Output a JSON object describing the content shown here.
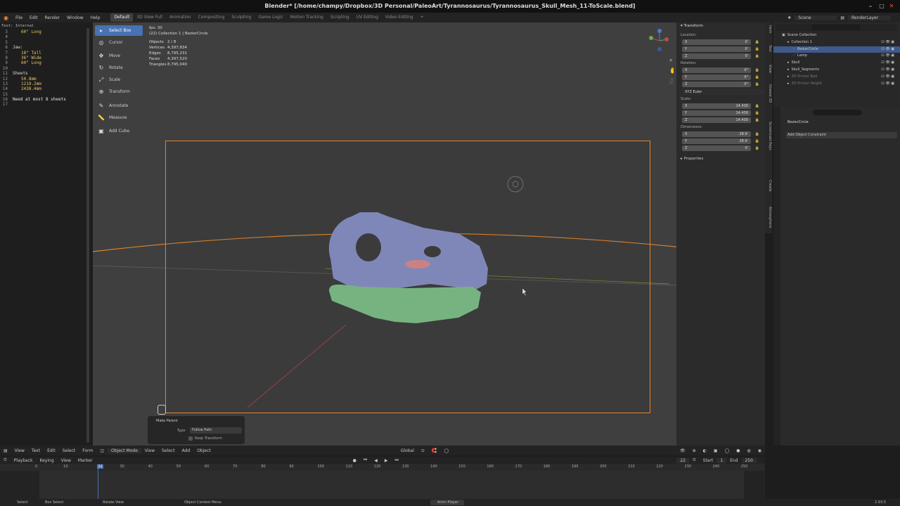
{
  "window": {
    "title": "Blender* [/home/champy/Dropbox/3D Personal/PaleoArt/Tyrannosaurus/Tyrannosaurus_Skull_Mesh_11-ToScale.blend]",
    "controls": [
      "–",
      "□",
      "✕"
    ]
  },
  "menu": [
    "File",
    "Edit",
    "Render",
    "Window",
    "Help"
  ],
  "workspaces": [
    "Default",
    "3D View Full",
    "Animation",
    "Compositing",
    "Sculpting",
    "Game Logic",
    "Motion Tracking",
    "Scripting",
    "UV Editing",
    "Video Editing",
    "+"
  ],
  "top_right": {
    "scene": "Scene",
    "render_layer": "RenderLayer"
  },
  "text_editor": {
    "header": "Text: Internal",
    "lines": [
      {
        "n": "3",
        "t": "60\" Long"
      },
      {
        "n": "4",
        "t": ""
      },
      {
        "n": "5",
        "t": ""
      },
      {
        "n": "6",
        "t": "Jaw:"
      },
      {
        "n": "7",
        "t": "18\" Tall"
      },
      {
        "n": "8",
        "t": "36\" Wide"
      },
      {
        "n": "9",
        "t": "60\" Long"
      },
      {
        "n": "10",
        "t": ""
      },
      {
        "n": "11",
        "t": "Sheets"
      },
      {
        "n": "12",
        "t": "50.8mm"
      },
      {
        "n": "13",
        "t": "1219.2mm"
      },
      {
        "n": "14",
        "t": "2438.4mm"
      },
      {
        "n": "15",
        "t": ""
      },
      {
        "n": "16",
        "t": "Need at most 8 sheets"
      },
      {
        "n": "17",
        "t": ""
      }
    ],
    "menu": [
      "View",
      "Text",
      "Edit",
      "Select",
      "Form"
    ]
  },
  "toolbar": [
    {
      "label": "Select Box",
      "icon": "select-box-icon",
      "glyph": "▸",
      "active": true
    },
    {
      "label": "Cursor",
      "icon": "cursor-icon",
      "glyph": "◎"
    },
    {
      "label": "Move",
      "icon": "move-icon",
      "glyph": "✥"
    },
    {
      "label": "Rotate",
      "icon": "rotate-icon",
      "glyph": "↻"
    },
    {
      "label": "Scale",
      "icon": "scale-icon",
      "glyph": "⤢"
    },
    {
      "label": "Transform",
      "icon": "transform-icon",
      "glyph": "⊕"
    },
    {
      "label": "Annotate",
      "icon": "annotate-icon",
      "glyph": "✎"
    },
    {
      "label": "Measure",
      "icon": "measure-icon",
      "glyph": "📏"
    },
    {
      "label": "Add Cube",
      "icon": "add-cube-icon",
      "glyph": "▣"
    }
  ],
  "stats": {
    "fps": "fps: 30",
    "collection": "(22) Collection 1 | BezierCircle",
    "rows": [
      {
        "k": "Objects",
        "v": "2 / 8"
      },
      {
        "k": "Vertices",
        "v": "4,397,834"
      },
      {
        "k": "Edges",
        "v": "8,795,231"
      },
      {
        "k": "Faces",
        "v": "4,397,520"
      },
      {
        "k": "Triangles",
        "v": "8,795,040"
      }
    ]
  },
  "operator_panel": {
    "title": "Make Parent",
    "type_label": "Type",
    "type_value": "Follow Path",
    "keep_transform": "Keep Transform"
  },
  "viewport_header": {
    "mode": "Object Mode",
    "menu": [
      "View",
      "Select",
      "Add",
      "Object"
    ],
    "orientation": "Global"
  },
  "transform": {
    "title": "Transform",
    "location_label": "Location:",
    "location": [
      {
        "a": "X",
        "v": "0'"
      },
      {
        "a": "Y",
        "v": "0'"
      },
      {
        "a": "Z",
        "v": "0'"
      }
    ],
    "rotation_label": "Rotation:",
    "rotation": [
      {
        "a": "X",
        "v": "0°"
      },
      {
        "a": "Y",
        "v": "0°"
      },
      {
        "a": "Z",
        "v": "0°"
      }
    ],
    "rotation_mode": "XYZ Euler",
    "scale_label": "Scale:",
    "scale": [
      {
        "a": "X",
        "v": "14.430"
      },
      {
        "a": "Y",
        "v": "14.430"
      },
      {
        "a": "Z",
        "v": "14.430"
      }
    ],
    "dimensions_label": "Dimensions:",
    "dimensions": [
      {
        "a": "X",
        "v": "28.9'"
      },
      {
        "a": "Y",
        "v": "28.9'"
      },
      {
        "a": "Z",
        "v": "0'"
      }
    ],
    "properties": "Properties"
  },
  "side_tabs": [
    "Item",
    "Tool",
    "View",
    "Grease 3D",
    "Screencast Keys",
    "Create",
    "Atmosphere"
  ],
  "outliner": {
    "rows": [
      {
        "label": "Scene Collection",
        "indent": 0
      },
      {
        "label": "Collection 1",
        "indent": 1
      },
      {
        "label": "BezierCircle",
        "indent": 2,
        "sel": true
      },
      {
        "label": "Lamp",
        "indent": 2
      },
      {
        "label": "Skull",
        "indent": 1
      },
      {
        "label": "Skull_Segments",
        "indent": 1
      },
      {
        "label": "3D Printer Bed",
        "indent": 1
      },
      {
        "label": "3D Printer Height",
        "indent": 1
      }
    ]
  },
  "constraint": {
    "object": "BezierCircle",
    "add": "Add Object Constraint"
  },
  "timeline": {
    "menu": [
      "Playback",
      "Keying",
      "View",
      "Marker"
    ],
    "current_frame": "22",
    "start_label": "Start",
    "start": "1",
    "end_label": "End",
    "end": "250",
    "ticks": [
      "0",
      "10",
      "22",
      "30",
      "40",
      "50",
      "60",
      "70",
      "80",
      "90",
      "100",
      "110",
      "120",
      "130",
      "140",
      "150",
      "160",
      "170",
      "180",
      "190",
      "200",
      "210",
      "220",
      "230",
      "240",
      "250"
    ]
  },
  "status": {
    "select": "Select",
    "box_select": "Box Select",
    "rotate_view": "Rotate View",
    "context_menu": "Object Context Menu",
    "anim_player": "Anim Player",
    "version": "2.93.5"
  },
  "colors": {
    "accent": "#4772b3",
    "camera_frame": "#e0842f",
    "skull_upper": "#8790c4",
    "skull_lower": "#7fbf8a",
    "tongue": "#d98a8a"
  }
}
